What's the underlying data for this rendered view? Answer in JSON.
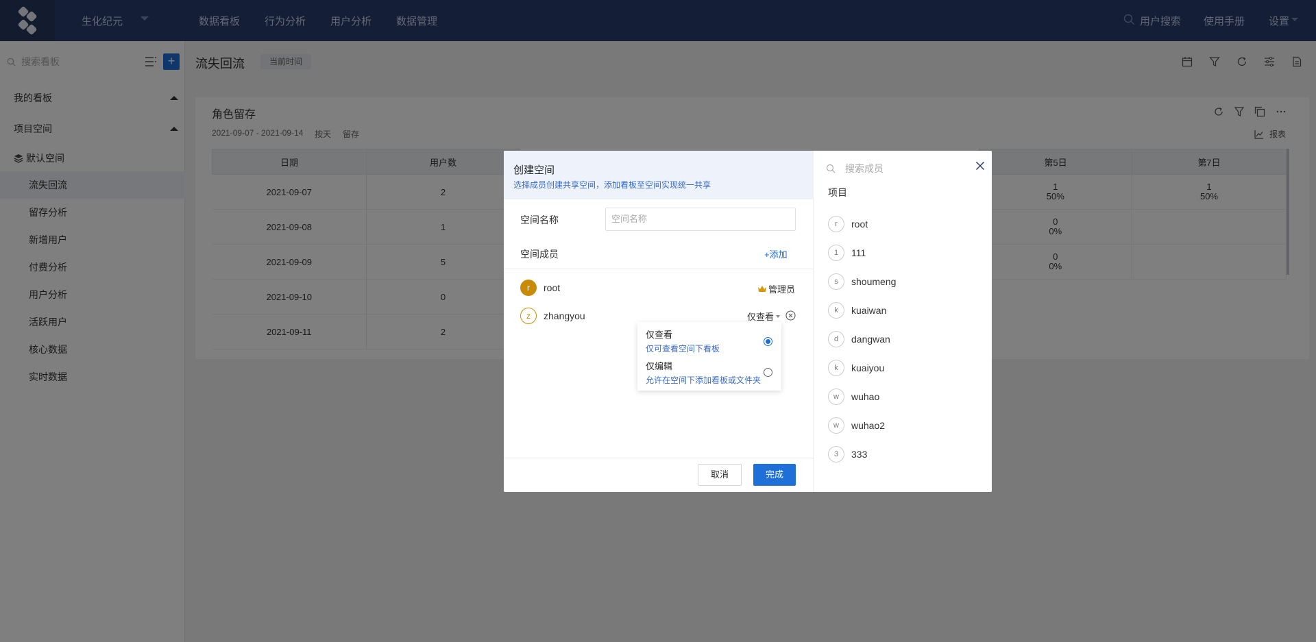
{
  "topnav": {
    "project": "生化纪元",
    "links": [
      "数据看板",
      "行为分析",
      "用户分析",
      "数据管理"
    ],
    "user_search": "用户搜索",
    "manual": "使用手册",
    "settings": "设置"
  },
  "sidebar": {
    "search_placeholder": "搜索看板",
    "add_label": "+",
    "my_boards": "我的看板",
    "project_space": "项目空间",
    "default_space": "默认空间",
    "items": [
      "流失回流",
      "留存分析",
      "新增用户",
      "付费分析",
      "用户分析",
      "活跃用户",
      "核心数据",
      "实时数据"
    ]
  },
  "main": {
    "title": "流失回流",
    "time_tag": "当前时间"
  },
  "card": {
    "title": "角色留存",
    "date_range": "2021-09-07 - 2021-09-14",
    "granularity": "按天",
    "metric": "留存",
    "report": "报表",
    "table": {
      "headers": [
        "日期",
        "用户数"
      ],
      "rows": [
        [
          "2021-09-07",
          "2"
        ],
        [
          "2021-09-08",
          "1"
        ],
        [
          "2021-09-09",
          "5"
        ],
        [
          "2021-09-10",
          "0"
        ],
        [
          "2021-09-11",
          "2"
        ]
      ]
    },
    "right_table": {
      "headers": [
        "第5日",
        "第7日"
      ],
      "rows": [
        [
          [
            "1",
            "50%"
          ],
          [
            "1",
            "50%"
          ]
        ],
        [
          [
            "0",
            "0%"
          ],
          [
            "",
            ""
          ]
        ],
        [
          [
            "0",
            "0%"
          ],
          [
            "",
            ""
          ]
        ]
      ]
    }
  },
  "modal": {
    "title": "创建空间",
    "subtitle": "选择成员创建共享空间，添加看板至空间实现统一共享",
    "name_label": "空间名称",
    "name_placeholder": "空间名称",
    "members_label": "空间成员",
    "add_link": "+添加",
    "members": [
      {
        "initial": "r",
        "name": "root",
        "role": "管理员"
      },
      {
        "initial": "z",
        "name": "zhangyou",
        "role": "仅查看"
      }
    ],
    "cancel": "取消",
    "confirm": "完成",
    "search_placeholder": "搜索成员",
    "section": "项目",
    "all_members": [
      {
        "initial": "r",
        "name": "root"
      },
      {
        "initial": "1",
        "name": "111"
      },
      {
        "initial": "s",
        "name": "shoumeng"
      },
      {
        "initial": "k",
        "name": "kuaiwan"
      },
      {
        "initial": "d",
        "name": "dangwan"
      },
      {
        "initial": "k",
        "name": "kuaiyou"
      },
      {
        "initial": "w",
        "name": "wuhao"
      },
      {
        "initial": "w",
        "name": "wuhao2"
      },
      {
        "initial": "3",
        "name": "333"
      }
    ]
  },
  "popover": {
    "options": [
      {
        "title": "仅查看",
        "desc": "仅可查看空间下看板",
        "selected": true
      },
      {
        "title": "仅编辑",
        "desc": "允许在空间下添加看板或文件夹",
        "selected": false
      }
    ]
  },
  "colors": {
    "nav_bg": "#2b3c6e",
    "accent": "#1f6fd9",
    "avatar": "#c98c09"
  }
}
